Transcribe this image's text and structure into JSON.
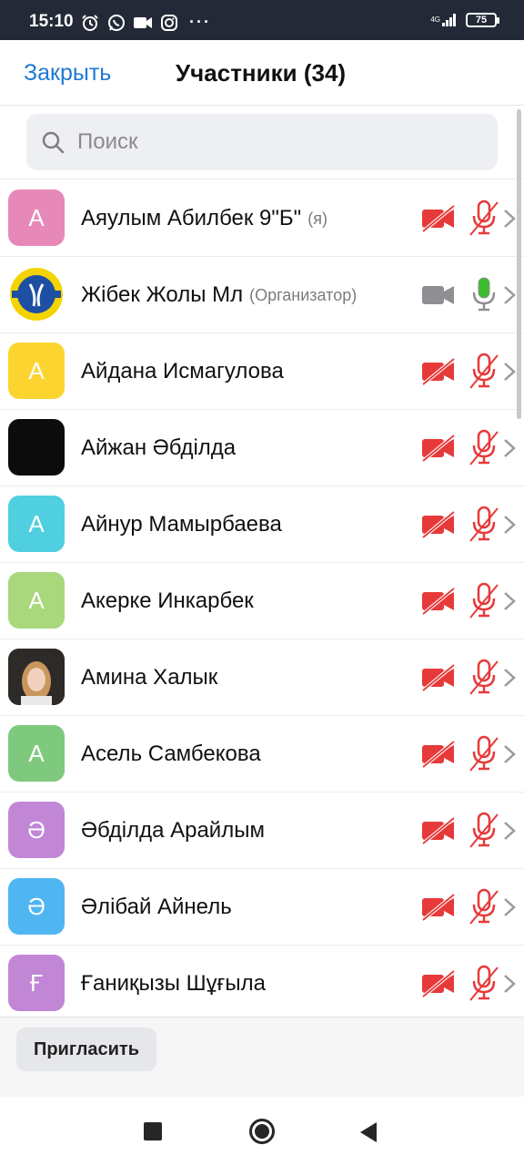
{
  "status_bar": {
    "time": "15:10",
    "icons": [
      "alarm-icon",
      "whatsapp-icon",
      "video-camera-icon",
      "instagram-icon"
    ],
    "more": "···",
    "network": "4G",
    "battery": "75"
  },
  "header": {
    "close_label": "Закрыть",
    "title": "Участники (34)"
  },
  "search": {
    "placeholder": "Поиск"
  },
  "colors": {
    "accent": "#1f79d4",
    "muted_red": "#e63a3a",
    "unmuted_green": "#3cbd2e",
    "neutral_gray": "#8f8f93"
  },
  "participants": [
    {
      "name": "Аяулым Абилбек 9\"Б\"",
      "tag": "(я)",
      "initial": "A",
      "avatar_color": "#e789b8",
      "video": "off",
      "mic": "muted"
    },
    {
      "name": "Жібек Жолы Мл",
      "tag": "(Организатор)",
      "initial": "",
      "avatar_color": "#f4d400",
      "video": "on",
      "mic": "on"
    },
    {
      "name": "Айдана Исмагулова",
      "tag": "",
      "initial": "A",
      "avatar_color": "#fbd430",
      "video": "off",
      "mic": "muted"
    },
    {
      "name": "Айжан Әбділда",
      "tag": "",
      "initial": "",
      "avatar_color": "#0c0c0c",
      "video": "off",
      "mic": "muted"
    },
    {
      "name": "Айнур Мамырбаева",
      "tag": "",
      "initial": "A",
      "avatar_color": "#4fcfe0",
      "video": "off",
      "mic": "muted"
    },
    {
      "name": "Акерке Инкарбек",
      "tag": "",
      "initial": "A",
      "avatar_color": "#a9d77c",
      "video": "off",
      "mic": "muted"
    },
    {
      "name": "Амина Халык",
      "tag": "",
      "initial": "",
      "avatar_color": "#3b3b3b",
      "video": "off",
      "mic": "muted"
    },
    {
      "name": "Асель Самбекова",
      "tag": "",
      "initial": "A",
      "avatar_color": "#7fc97f",
      "video": "off",
      "mic": "muted"
    },
    {
      "name": "Әбділда Арайлым",
      "tag": "",
      "initial": "Ә",
      "avatar_color": "#c187d6",
      "video": "off",
      "mic": "muted"
    },
    {
      "name": "Әлібай Айнель",
      "tag": "",
      "initial": "Ә",
      "avatar_color": "#4fb6f2",
      "video": "off",
      "mic": "muted"
    },
    {
      "name": "Ғаниқызы Шұғыла",
      "tag": "",
      "initial": "Ғ",
      "avatar_color": "#c187d6",
      "video": "off",
      "mic": "muted"
    }
  ],
  "footer": {
    "invite_label": "Пригласить"
  }
}
